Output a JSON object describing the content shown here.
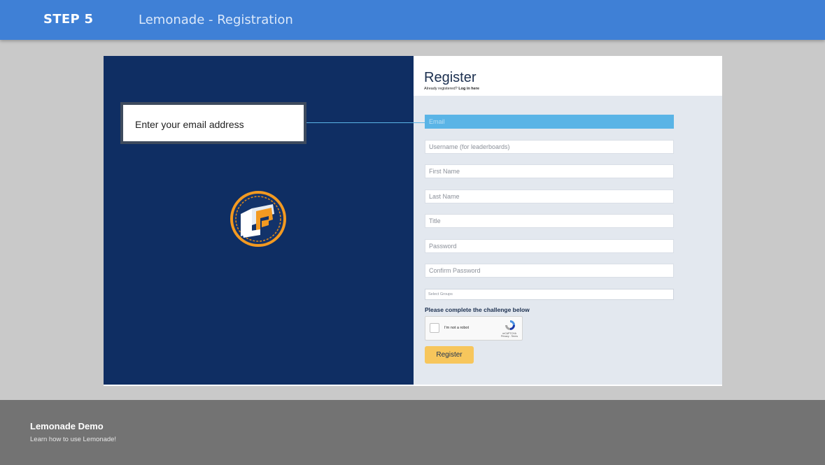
{
  "header": {
    "step": "STEP 5",
    "title": "Lemonade - Registration"
  },
  "callout": {
    "text": "Enter your email address"
  },
  "form": {
    "title": "Register",
    "already_registered": "Already registered?",
    "login_link": "Log in here",
    "fields": {
      "email": "Email",
      "username": "Username (for leaderboards)",
      "first_name": "First Name",
      "last_name": "Last Name",
      "title": "Title",
      "password": "Password",
      "confirm_password": "Confirm Password",
      "select_groups": "Select Groups"
    },
    "challenge": "Please complete the challenge below",
    "captcha": {
      "label": "I'm not a robot",
      "brand": "reCAPTCHA",
      "links": "Privacy - Terms"
    },
    "submit_label": "Register"
  },
  "footer": {
    "title": "Lemonade Demo",
    "subtitle": "Learn how to use Lemonade!"
  },
  "colors": {
    "header": "#3f80d6",
    "left_panel": "#0f2e63",
    "highlight": "#5ab4e6",
    "button": "#f7c65c",
    "footer": "#737373"
  }
}
